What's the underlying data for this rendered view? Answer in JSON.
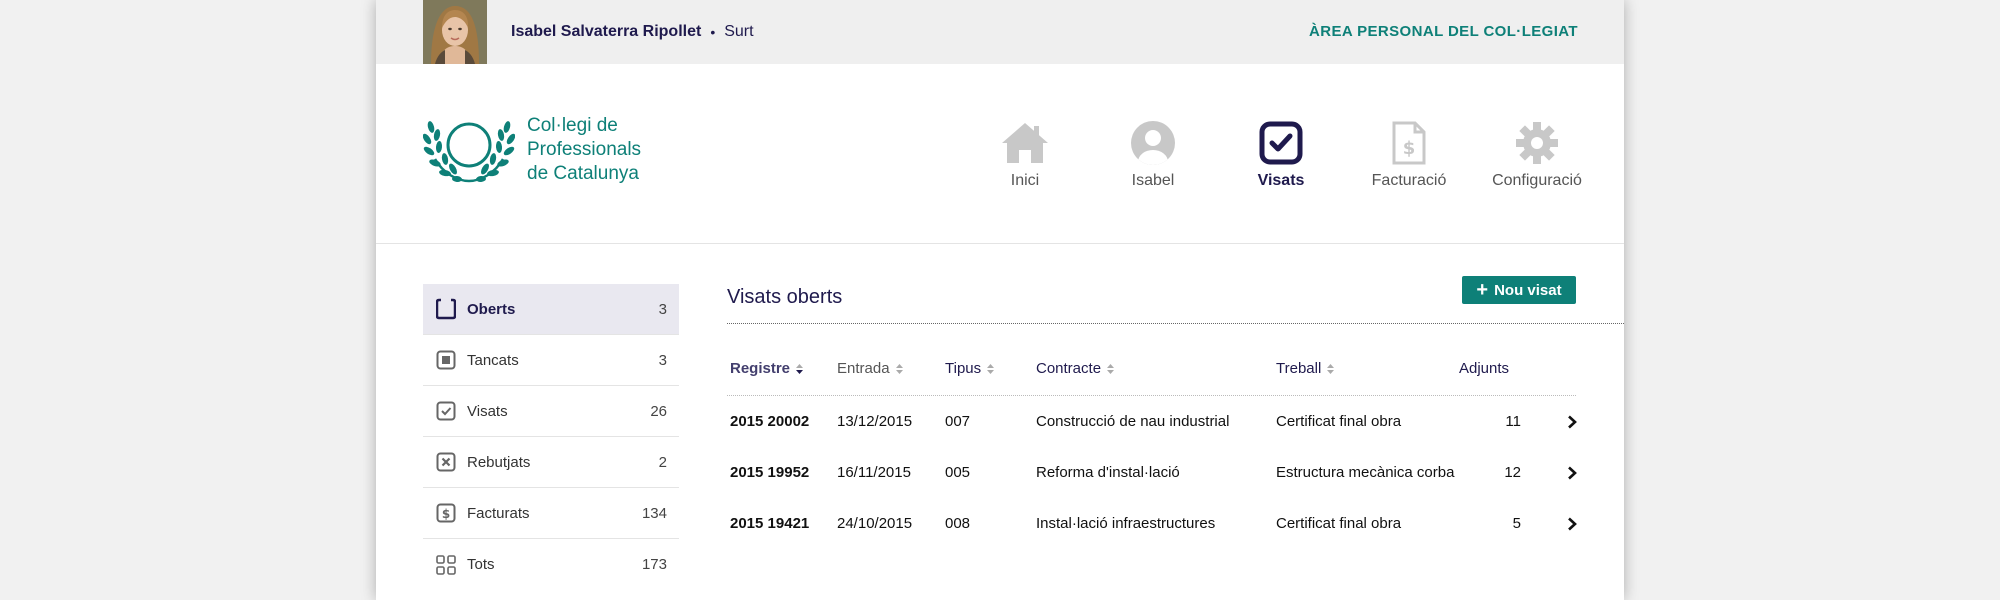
{
  "topbar": {
    "user_name": "Isabel Salvaterra Ripollet",
    "separator": "•",
    "logout": "Surt",
    "area_title": "ÀREA PERSONAL DEL COL·LEGIAT"
  },
  "logo": {
    "line1": "Col·legi de",
    "line2": "Professionals",
    "line3": "de Catalunya"
  },
  "nav": [
    {
      "label": "Inici",
      "icon": "house-icon"
    },
    {
      "label": "Isabel",
      "icon": "user-icon"
    },
    {
      "label": "Visats",
      "icon": "checkbox-icon",
      "active": true
    },
    {
      "label": "Facturació",
      "icon": "invoice-icon"
    },
    {
      "label": "Configuració",
      "icon": "gear-icon"
    }
  ],
  "sidebar": [
    {
      "label": "Oberts",
      "count": "3",
      "icon": "open-square-icon",
      "active": true
    },
    {
      "label": "Tancats",
      "count": "3",
      "icon": "closed-square-icon"
    },
    {
      "label": "Visats",
      "count": "26",
      "icon": "check-square-icon"
    },
    {
      "label": "Rebutjats",
      "count": "2",
      "icon": "x-square-icon"
    },
    {
      "label": "Facturats",
      "count": "134",
      "icon": "dollar-square-icon"
    },
    {
      "label": "Tots",
      "count": "173",
      "icon": "grid-icon"
    }
  ],
  "main": {
    "title": "Visats oberts",
    "new_button": "Nou visat"
  },
  "table": {
    "headers": [
      "Registre",
      "Entrada",
      "Tipus",
      "Contracte",
      "Treball",
      "Adjunts"
    ],
    "rows": [
      [
        "2015 20002",
        "13/12/2015",
        "007",
        "Construcció de nau industrial",
        "Certificat final obra",
        "11"
      ],
      [
        "2015 19952",
        "16/11/2015",
        "005",
        "Reforma d'instal·lació",
        "Estructura mecànica corba",
        "12"
      ],
      [
        "2015 19421",
        "24/10/2015",
        "008",
        "Instal·lació infraestructures",
        "Certificat final obra",
        "5"
      ]
    ]
  },
  "colors": {
    "accent": "#0e8078",
    "navy": "#1f1a4d"
  }
}
